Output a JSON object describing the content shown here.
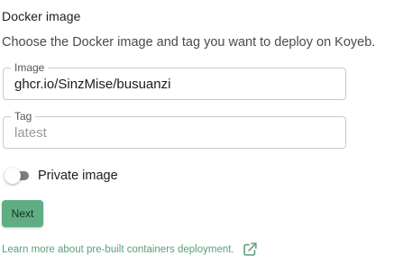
{
  "section": {
    "title": "Docker image",
    "description": "Choose the Docker image and tag you want to deploy on Koyeb."
  },
  "image_field": {
    "label": "Image",
    "value": "ghcr.io/SinzMise/busuanzi",
    "placeholder": ""
  },
  "tag_field": {
    "label": "Tag",
    "value": "",
    "placeholder": "latest"
  },
  "private_toggle": {
    "label": "Private image",
    "checked": false
  },
  "next_button": {
    "label": "Next"
  },
  "learn_more": {
    "label": "Learn more about pre-built containers deployment.",
    "icon": "external-link-icon"
  },
  "colors": {
    "accent": "#5fad83",
    "link": "#5b9e78",
    "toggle_track": "#7d7d7d"
  }
}
